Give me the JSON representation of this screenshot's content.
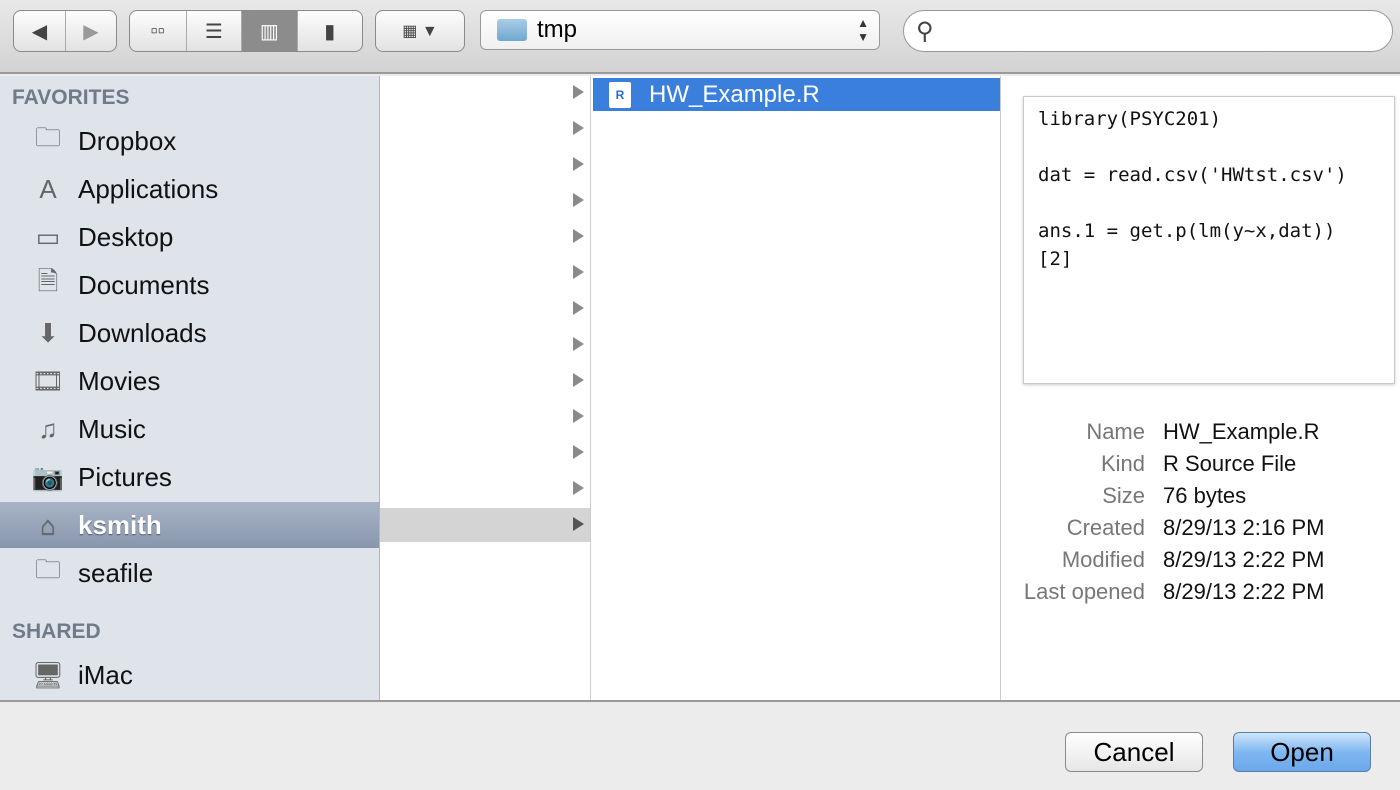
{
  "toolbar": {
    "path": "tmp",
    "search_placeholder": "",
    "back": "◀",
    "forward": "▶"
  },
  "sidebar": {
    "favorites_header": "FAVORITES",
    "items": [
      {
        "label": "Dropbox",
        "icon": "folder-icon"
      },
      {
        "label": "Applications",
        "icon": "applications-icon"
      },
      {
        "label": "Desktop",
        "icon": "desktop-icon"
      },
      {
        "label": "Documents",
        "icon": "documents-icon"
      },
      {
        "label": "Downloads",
        "icon": "downloads-icon"
      },
      {
        "label": "Movies",
        "icon": "movies-icon"
      },
      {
        "label": "Music",
        "icon": "music-icon"
      },
      {
        "label": "Pictures",
        "icon": "pictures-icon"
      },
      {
        "label": "ksmith",
        "icon": "home-icon",
        "selected": true
      },
      {
        "label": "seafile",
        "icon": "folder-icon"
      }
    ],
    "shared_header": "SHARED",
    "shared": [
      {
        "label": "iMac",
        "icon": "imac-icon"
      }
    ]
  },
  "column2": {
    "file": "HW_Example.R"
  },
  "preview": {
    "code": "library(PSYC201)\n\ndat = read.csv('HWtst.csv')\n\nans.1 = get.p(lm(y~x,dat))\n[2]",
    "info": [
      {
        "k": "Name",
        "v": "HW_Example.R"
      },
      {
        "k": "Kind",
        "v": "R Source File"
      },
      {
        "k": "Size",
        "v": "76 bytes"
      },
      {
        "k": "Created",
        "v": "8/29/13 2:16 PM"
      },
      {
        "k": "Modified",
        "v": "8/29/13 2:22 PM"
      },
      {
        "k": "Last opened",
        "v": "8/29/13 2:22 PM"
      }
    ]
  },
  "buttons": {
    "cancel": "Cancel",
    "open": "Open"
  },
  "colors": {
    "selection": "#3a7fdc",
    "sidebar": "#dfe4ea"
  }
}
